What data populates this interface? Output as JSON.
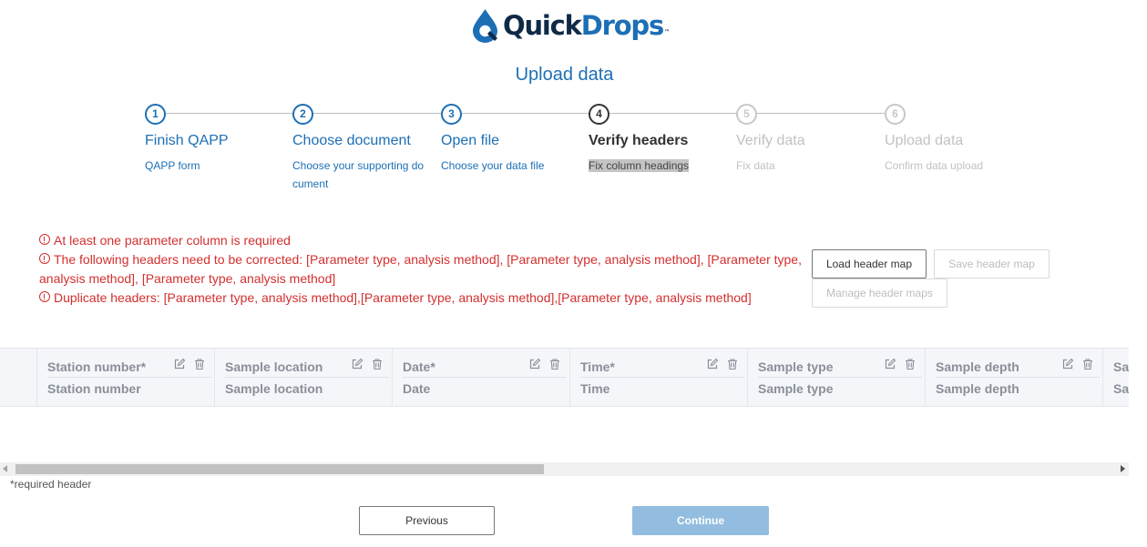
{
  "brand": {
    "name_part1": "Quick",
    "name_part2": "Drops",
    "trademark": "™",
    "primary_color": "#1d6fb5",
    "dark_color": "#0f2a47"
  },
  "page": {
    "title": "Upload data"
  },
  "steps": [
    {
      "number": "1",
      "title": "Finish QAPP",
      "subtitle": "QAPP form",
      "state": "complete"
    },
    {
      "number": "2",
      "title": "Choose document",
      "subtitle": "Choose your supporting document",
      "state": "complete"
    },
    {
      "number": "3",
      "title": "Open file",
      "subtitle": "Choose your data file",
      "state": "complete"
    },
    {
      "number": "4",
      "title": "Verify headers",
      "subtitle": "Fix column headings",
      "state": "active"
    },
    {
      "number": "5",
      "title": "Verify data",
      "subtitle": "Fix data",
      "state": "future"
    },
    {
      "number": "6",
      "title": "Upload data",
      "subtitle": "Confirm data upload",
      "state": "future"
    }
  ],
  "errors": [
    "At least one parameter column is required",
    "The following headers need to be corrected: [Parameter type, analysis method], [Parameter type, analysis method], [Parameter type, analysis method], [Parameter type, analysis method]",
    "Duplicate headers: [Parameter type, analysis method],[Parameter type, analysis method],[Parameter type, analysis method]"
  ],
  "error_color": "#d32f2f",
  "header_map": {
    "load_label": "Load header map",
    "save_label": "Save header map",
    "manage_label": "Manage header maps"
  },
  "table": {
    "columns": [
      {
        "name": "Station number*",
        "mapped": "Station number"
      },
      {
        "name": "Sample location",
        "mapped": "Sample location"
      },
      {
        "name": "Date*",
        "mapped": "Date"
      },
      {
        "name": "Time*",
        "mapped": "Time"
      },
      {
        "name": "Sample type",
        "mapped": "Sample type"
      },
      {
        "name": "Sample depth",
        "mapped": "Sample depth"
      },
      {
        "name": "Sa",
        "mapped": "Sa"
      }
    ],
    "icons": {
      "edit": "edit-icon",
      "delete": "trash-icon"
    }
  },
  "footnote": "*required header",
  "nav": {
    "previous_label": "Previous",
    "continue_label": "Continue"
  }
}
